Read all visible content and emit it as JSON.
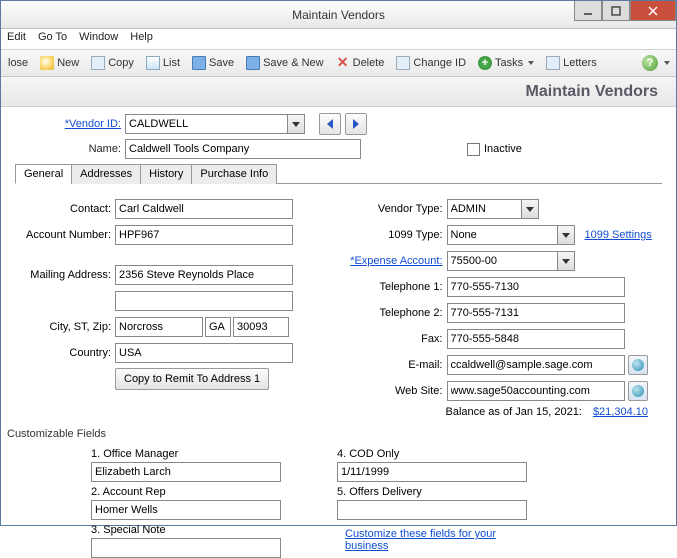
{
  "window": {
    "title": "Maintain Vendors"
  },
  "menu": {
    "edit": "Edit",
    "goto": "Go To",
    "window": "Window",
    "help": "Help"
  },
  "toolbar": {
    "close": "lose",
    "new": "New",
    "copy": "Copy",
    "list": "List",
    "save": "Save",
    "saveNew": "Save & New",
    "delete": "Delete",
    "changeId": "Change ID",
    "tasks": "Tasks",
    "letters": "Letters"
  },
  "header": {
    "title": "Maintain Vendors"
  },
  "top_form": {
    "vendor_id_label": "Vendor ID:",
    "vendor_id": "CALDWELL",
    "name_label": "Name:",
    "name": "Caldwell Tools Company",
    "inactive_label": "Inactive"
  },
  "tabs": {
    "general": "General",
    "addresses": "Addresses",
    "history": "History",
    "purchase": "Purchase Info"
  },
  "left": {
    "contact_label": "Contact:",
    "contact": "Carl Caldwell",
    "account_label": "Account Number:",
    "account": "HPF967",
    "mail_label": "Mailing Address:",
    "mail1": "2356 Steve Reynolds Place",
    "mail2": "",
    "csz_label": "City, ST, Zip:",
    "city": "Norcross",
    "state": "GA",
    "zip": "30093",
    "country_label": "Country:",
    "country": "USA",
    "copy_btn": "Copy to Remit To Address 1"
  },
  "right": {
    "vendor_type_label": "Vendor Type:",
    "vendor_type": "ADMIN",
    "t1099_label": "1099 Type:",
    "t1099": "None",
    "t1099_link": "1099 Settings",
    "expense_label": "Expense Account:",
    "expense": "75500-00",
    "tel1_label": "Telephone 1:",
    "tel1": "770-555-7130",
    "tel2_label": "Telephone 2:",
    "tel2": "770-555-7131",
    "fax_label": "Fax:",
    "fax": "770-555-5848",
    "email_label": "E-mail:",
    "email": "ccaldwell@sample.sage.com",
    "web_label": "Web Site:",
    "web": "www.sage50accounting.com",
    "balance_label": "Balance as of Jan 15, 2021:",
    "balance_value": "$21,304.10"
  },
  "custom": {
    "title": "Customizable Fields",
    "f1_label": "1. Office Manager",
    "f1": "Elizabeth Larch",
    "f2_label": "2. Account Rep",
    "f2": "Homer Wells",
    "f3_label": "3. Special Note",
    "f3": "",
    "f4_label": "4. COD Only",
    "f4": "1/11/1999",
    "f5_label": "5. Offers Delivery",
    "f5": "",
    "link": "Customize these fields for your business"
  }
}
